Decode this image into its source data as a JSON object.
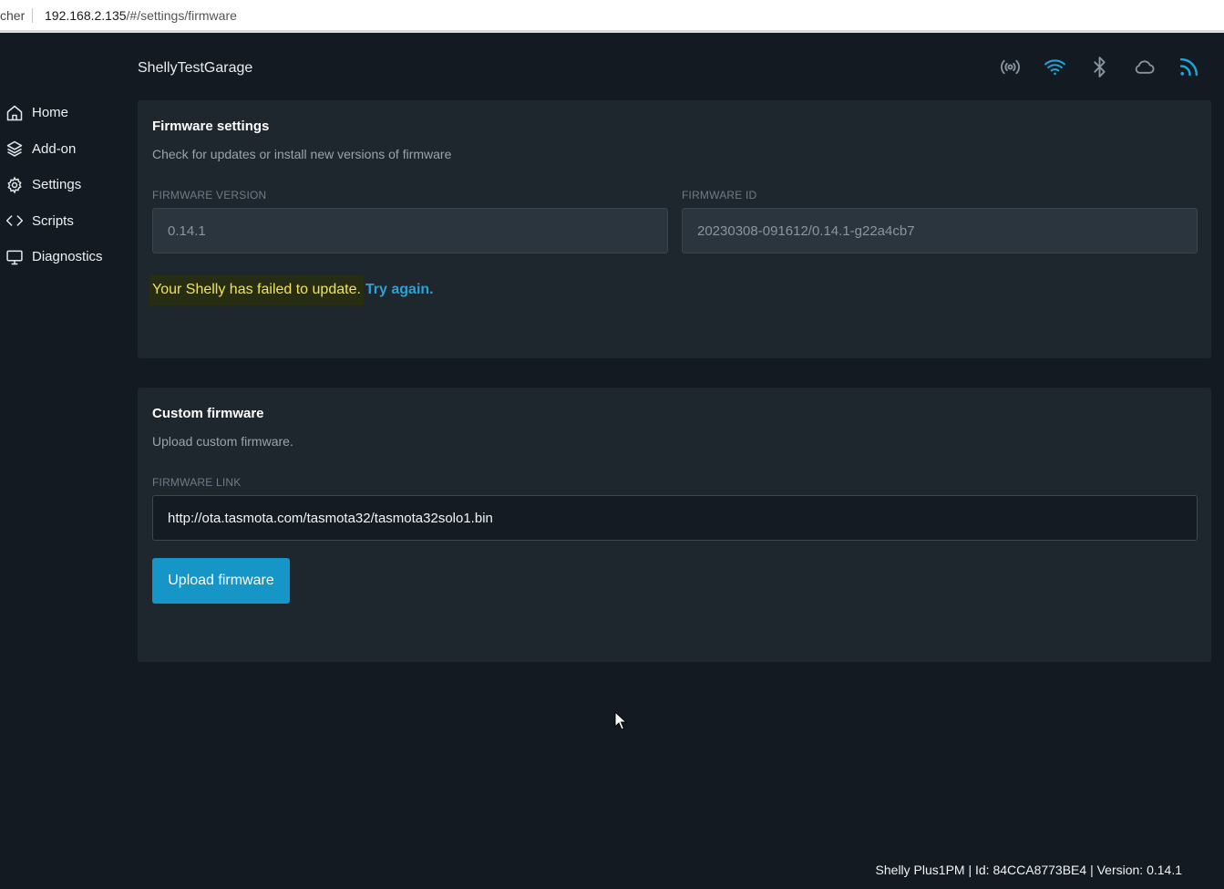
{
  "browser": {
    "tab_fragment": "cher",
    "url_host": "192.168.2.135",
    "url_path": "/#/settings/firmware"
  },
  "header": {
    "device_name": "ShellyTestGarage",
    "status_icons": [
      "broadcast-icon",
      "wifi-icon",
      "bluetooth-icon",
      "cloud-icon",
      "rss-icon"
    ]
  },
  "sidebar": {
    "items": [
      {
        "label": "Home",
        "icon": "home-icon"
      },
      {
        "label": "Add-on",
        "icon": "layers-icon"
      },
      {
        "label": "Settings",
        "icon": "gear-icon"
      },
      {
        "label": "Scripts",
        "icon": "code-icon"
      },
      {
        "label": "Diagnostics",
        "icon": "monitor-icon"
      }
    ]
  },
  "firmware_settings": {
    "title": "Firmware settings",
    "subtitle": "Check for updates or install new versions of firmware",
    "version_label": "FIRMWARE VERSION",
    "version_value": "0.14.1",
    "id_label": "FIRMWARE ID",
    "id_value": "20230308-091612/0.14.1-g22a4cb7",
    "fail_message": "Your Shelly has failed to update.",
    "retry_link": "Try again."
  },
  "custom_firmware": {
    "title": "Custom firmware",
    "subtitle": "Upload custom firmware.",
    "link_label": "FIRMWARE LINK",
    "link_value": "http://ota.tasmota.com/tasmota32/tasmota32solo1.bin",
    "upload_label": "Upload firmware"
  },
  "footer": {
    "text": "Shelly Plus1PM | Id: 84CCA8773BE4 | Version: 0.14.1"
  },
  "colors": {
    "background": "#131a21",
    "card": "#1e262e",
    "accent": "#1596c7",
    "warning_text": "#f5e25a"
  }
}
